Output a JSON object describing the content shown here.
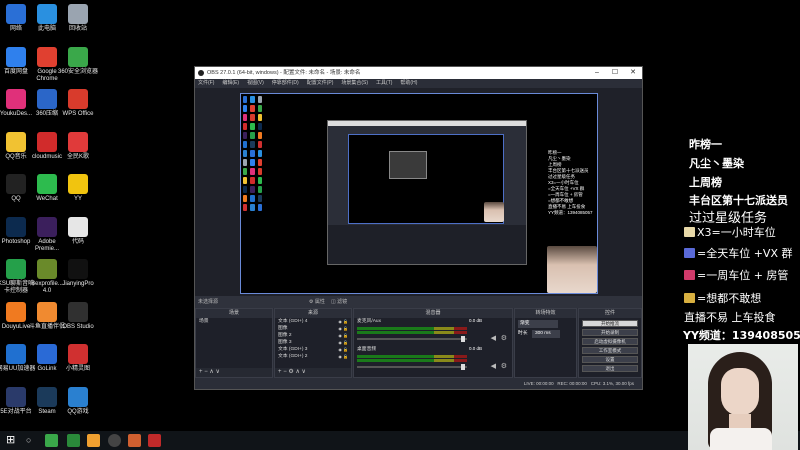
{
  "desktop": {
    "icons": [
      {
        "label": "网络",
        "icon": "network-icon",
        "color": "#2a6fd6"
      },
      {
        "label": "此电脑",
        "icon": "computer-icon",
        "color": "#2a90e0"
      },
      {
        "label": "回收站",
        "icon": "recycle-bin-icon",
        "color": "#9aa4b0"
      },
      {
        "label": "百度网盘",
        "icon": "baidu-netdisk-icon",
        "color": "#2f80ed"
      },
      {
        "label": "Google Chrome",
        "icon": "chrome-icon",
        "color": "#e04030"
      },
      {
        "label": "360安全浏览器",
        "icon": "360-browser-icon",
        "color": "#3aa84a"
      },
      {
        "label": "YoukuDes...",
        "icon": "youku-icon",
        "color": "#e0307a"
      },
      {
        "label": "360压缩",
        "icon": "360-zip-icon",
        "color": "#2b66c8"
      },
      {
        "label": "WPS Office",
        "icon": "wps-icon",
        "color": "#d83b2c"
      },
      {
        "label": "QQ音乐",
        "icon": "qq-music-icon",
        "color": "#f1c232"
      },
      {
        "label": "cloudmusic",
        "icon": "cloudmusic-icon",
        "color": "#d12b2b"
      },
      {
        "label": "全民K歌",
        "icon": "kge-icon",
        "color": "#e03a3a"
      },
      {
        "label": "QQ",
        "icon": "qq-icon",
        "color": "#222222"
      },
      {
        "label": "WeChat",
        "icon": "wechat-icon",
        "color": "#2dbb4e"
      },
      {
        "label": "YY",
        "icon": "yy-icon",
        "color": "#f1c40f"
      },
      {
        "label": "Photoshop",
        "icon": "photoshop-icon",
        "color": "#0c2a4e"
      },
      {
        "label": "Adobe Premie...",
        "icon": "premiere-icon",
        "color": "#3b1f5c"
      },
      {
        "label": "代码",
        "icon": "file-icon",
        "color": "#e6e6e6"
      },
      {
        "label": "KSU聊斯音响卡控制器",
        "icon": "ksu-icon",
        "color": "#25a04a"
      },
      {
        "label": "Bexprofile... 4.0",
        "icon": "bexprofile-icon",
        "color": "#6a8a2a"
      },
      {
        "label": "JianyingPro",
        "icon": "jianying-icon",
        "color": "#111111"
      },
      {
        "label": "DouyuLive",
        "icon": "douyu-icon",
        "color": "#f07a20"
      },
      {
        "label": "斗鱼直播伴侣",
        "icon": "douyu-companion-icon",
        "color": "#f08a30"
      },
      {
        "label": "OBS Studio",
        "icon": "obs-icon",
        "color": "#303030"
      },
      {
        "label": "网易UU加速器",
        "icon": "uu-icon",
        "color": "#2070d0"
      },
      {
        "label": "GoLink",
        "icon": "golink-icon",
        "color": "#2a6ad6"
      },
      {
        "label": "小精灵图",
        "icon": "sprite-icon",
        "color": "#d03030"
      },
      {
        "label": "5E对战平台",
        "icon": "5e-icon",
        "color": "#2a3a6a"
      },
      {
        "label": "Steam",
        "icon": "steam-icon",
        "color": "#1b3a5a"
      },
      {
        "label": "QQ游戏",
        "icon": "qq-game-icon",
        "color": "#2a80d0"
      }
    ]
  },
  "obs": {
    "title": "OBS 27.0.1 (64-bit, windows) - 配置文件: 未命名 - 场景: 未命名",
    "menu": [
      "文件(F)",
      "编辑(E)",
      "视图(V)",
      "停靠部件(D)",
      "配置文件(P)",
      "场景集合(S)",
      "工具(T)",
      "帮助(H)"
    ],
    "scene_bar": "未选择源",
    "properties_btn": "属性",
    "filters_btn": "滤镜",
    "docks": {
      "scenes": {
        "title": "场景",
        "items": [
          "场景"
        ]
      },
      "sources": {
        "title": "来源",
        "items": [
          "文本 (GDI+) 4",
          "图像",
          "图像 2",
          "图像 3",
          "文本 (GDI+) 3",
          "文本 (GDI+) 2"
        ]
      },
      "mixer": {
        "title": "混音器",
        "tracks": [
          {
            "name": "麦克风/Aux",
            "level": "0.0 dB"
          },
          {
            "name": "桌面音频",
            "level": "0.0 dB"
          }
        ]
      },
      "transitions": {
        "title": "转场特效",
        "type": "渐变",
        "duration_label": "时长",
        "duration": "300 ms"
      },
      "controls": {
        "title": "控件",
        "buttons": [
          "开始推流",
          "开始录制",
          "启动虚拟摄像机",
          "工作室模式",
          "设置",
          "退出"
        ]
      }
    },
    "status": {
      "live": "LIVE: 00:00:00",
      "rec": "REC: 00:00:00",
      "cpu": "CPU: 3.1%, 30.00 fps"
    }
  },
  "overlay": {
    "lines": [
      {
        "text": "昨榜一",
        "color": "#ffffff"
      },
      {
        "text": "凡尘丶墨染",
        "color": "#ffffff"
      },
      {
        "text": "上周榜",
        "color": "#ffffff"
      },
      {
        "text": "丰台区第十七派送员",
        "color": "#ffffff"
      },
      {
        "text": "过过星级任务",
        "color": "#ffffff"
      }
    ],
    "rules": [
      {
        "text": "X3=一小时车位",
        "icon": "ticket-icon",
        "color": "#e8d9a8"
      },
      {
        "text": "=全天车位 +VX 群",
        "icon": "rocket-icon",
        "color": "#5a6ad8"
      },
      {
        "text": "=一周车位 + 房管",
        "icon": "castle-icon",
        "color": "#d03a6a"
      },
      {
        "text": "=想都不敢想",
        "icon": "gold-icon",
        "color": "#d8b040"
      }
    ],
    "footer": "直播不易 上车投食",
    "yy": "YY频道：1394085057"
  }
}
